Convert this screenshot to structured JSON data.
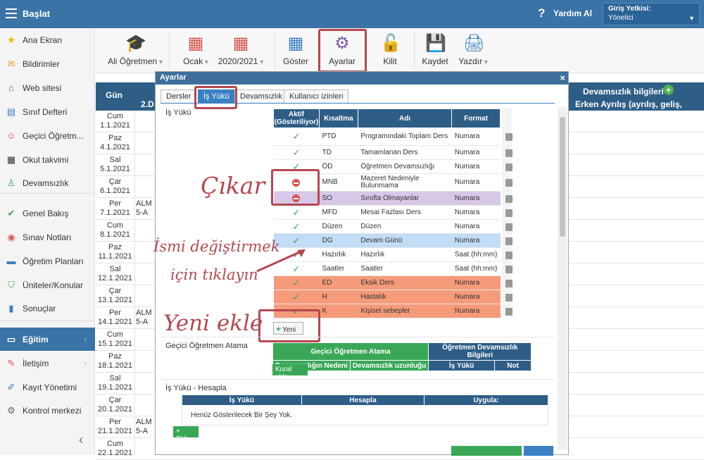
{
  "topbar": {
    "title": "Başlat",
    "help": "Yardım Al",
    "role_label": "Giriş Yetkisi:",
    "role_value": "Yönetici"
  },
  "sidebar": {
    "items": [
      {
        "label": "Ana Ekran",
        "icon": "star-icon"
      },
      {
        "label": "Bildirimler",
        "icon": "envelope-icon"
      },
      {
        "label": "Web sitesi",
        "icon": "home-icon"
      },
      {
        "label": "Sınıf Defteri",
        "icon": "notebook-icon"
      },
      {
        "label": "Geçici Öğretm...",
        "icon": "user-icon"
      },
      {
        "label": "Okul takvimi",
        "icon": "calendar-icon"
      },
      {
        "label": "Devamsızlık",
        "icon": "person-icon"
      },
      {
        "label": "Genel Bakış",
        "icon": "check-circle-icon"
      },
      {
        "label": "Sınav Notları",
        "icon": "chart-circle-icon"
      },
      {
        "label": "Öğretim Planları",
        "icon": "briefcase-icon"
      },
      {
        "label": "Üniteler/Konular",
        "icon": "shield-icon"
      },
      {
        "label": "Sonuçlar",
        "icon": "bar-chart-icon"
      },
      {
        "label": "Eğitim",
        "icon": "book-icon"
      },
      {
        "label": "İletişim",
        "icon": "chat-icon"
      },
      {
        "label": "Kayıt Yönetimi",
        "icon": "pencil-icon"
      },
      {
        "label": "Kontrol merkezi",
        "icon": "gear-icon"
      }
    ]
  },
  "toolbar": {
    "items": [
      {
        "label": "Ali Öğretmen",
        "icon": "graduation-cap-icon",
        "dropdown": true
      },
      {
        "label": "Ocak",
        "icon": "calendar-icon",
        "dropdown": true
      },
      {
        "label": "2020/2021",
        "icon": "calendar-icon",
        "dropdown": true
      },
      {
        "label": "Göster",
        "icon": "grid-icon",
        "dropdown": false
      },
      {
        "label": "Ayarlar",
        "icon": "gear-icon",
        "dropdown": false
      },
      {
        "label": "Kilit",
        "icon": "lock-icon",
        "dropdown": false
      },
      {
        "label": "Kaydet",
        "icon": "floppy-icon",
        "dropdown": false
      },
      {
        "label": "Yazdır",
        "icon": "printer-icon",
        "dropdown": true
      }
    ]
  },
  "grid": {
    "gun": "Gün",
    "col2": "2.D",
    "devam": "Devamsızlık bilgileri",
    "erken": "Erken Ayrılış (ayrılış, geliş, sebep)",
    "rows": [
      {
        "day": "Cum",
        "date": "1.1.2021",
        "extra": ""
      },
      {
        "day": "Paz",
        "date": "4.1.2021",
        "extra": ""
      },
      {
        "day": "Sal",
        "date": "5.1.2021",
        "extra": ""
      },
      {
        "day": "Çar",
        "date": "6.1.2021",
        "extra": ""
      },
      {
        "day": "Per",
        "date": "7.1.2021",
        "extra": "ALM\n5-A"
      },
      {
        "day": "Cum",
        "date": "8.1.2021",
        "extra": ""
      },
      {
        "day": "Paz",
        "date": "11.1.2021",
        "extra": ""
      },
      {
        "day": "Sal",
        "date": "12.1.2021",
        "extra": ""
      },
      {
        "day": "Çar",
        "date": "13.1.2021",
        "extra": ""
      },
      {
        "day": "Per",
        "date": "14.1.2021",
        "extra": "ALM\n5-A"
      },
      {
        "day": "Cum",
        "date": "15.1.2021",
        "extra": ""
      },
      {
        "day": "Paz",
        "date": "18.1.2021",
        "extra": ""
      },
      {
        "day": "Sal",
        "date": "19.1.2021",
        "extra": ""
      },
      {
        "day": "Çar",
        "date": "20.1.2021",
        "extra": ""
      },
      {
        "day": "Per",
        "date": "21.1.2021",
        "extra": "ALM\n5-A"
      },
      {
        "day": "Cum",
        "date": "22.1.2021",
        "extra": ""
      }
    ]
  },
  "dialog": {
    "title": "Ayarlar",
    "tabs": [
      "Dersler",
      "İş Yükü",
      "Devamsızlık",
      "Kullanıcı izinleri"
    ],
    "section_label": "İş Yükü",
    "columns": [
      "Aktif (Gösteriliyor)",
      "Kısaltma",
      "Adı",
      "Format"
    ],
    "rows": [
      {
        "active": "check",
        "abbr": "PTD",
        "name": "Programındaki Toplam Ders",
        "format": "Numara",
        "style": ""
      },
      {
        "active": "check",
        "abbr": "TD",
        "name": "Tamamlanan Ders",
        "format": "Numara",
        "style": ""
      },
      {
        "active": "check",
        "abbr": "ÖD",
        "name": "Öğretmen Devamsızlığı",
        "format": "Numara",
        "style": ""
      },
      {
        "active": "stop",
        "abbr": "MNB",
        "name": "Mazeret Nedeniyle Bulunmama",
        "format": "Numara",
        "style": ""
      },
      {
        "active": "stop",
        "abbr": "SO",
        "name": "Sınıfta Olmayanlar",
        "format": "Numara",
        "style": "purple"
      },
      {
        "active": "check",
        "abbr": "MFD",
        "name": "Mesai Fazlası Ders",
        "format": "Numara",
        "style": ""
      },
      {
        "active": "check",
        "abbr": "Düzen",
        "name": "Düzen",
        "format": "Numara",
        "style": ""
      },
      {
        "active": "check",
        "abbr": "DG",
        "name": "Devam Günü",
        "format": "Numara",
        "style": "blue"
      },
      {
        "active": "check",
        "abbr": "Hazırlık",
        "name": "Hazırlık",
        "format": "Saat (hh:mm)",
        "style": ""
      },
      {
        "active": "check",
        "abbr": "Saatler",
        "name": "Saatler",
        "format": "Saat (hh:mm)",
        "style": ""
      },
      {
        "active": "check",
        "abbr": "ED",
        "name": "Eksik Ders",
        "format": "Numara",
        "style": "orange"
      },
      {
        "active": "check",
        "abbr": "H",
        "name": "Hastalık",
        "format": "Numara",
        "style": "orange"
      },
      {
        "active": "check",
        "abbr": "K",
        "name": "Kişisel sebepler",
        "format": "Numara",
        "style": "orange"
      }
    ],
    "yeni": "Yeni",
    "gecici_label": "Geçici Öğretmen Atama",
    "ta_head1": "Geçici Öğretmen Atama",
    "ta_head2": "Öğretmen Devamsızlık Bilgileri",
    "ta_sub": [
      "Devamsızlığın Nedeni",
      "Devamsızlık uzunluğu",
      "İş Yükü",
      "Not"
    ],
    "kural": "Kural ekle",
    "hesap_label": "İş Yükü - Hesapla",
    "hesap_cols": [
      "İş Yükü",
      "Hesapla",
      "Uygula:"
    ],
    "hesap_empty": "Henüz Gösterilecek Bir Şey Yok.",
    "ekle": "+ Ekle"
  },
  "annotations": {
    "cikar": "Çıkar",
    "ismi1": "İsmi değiştirmek",
    "ismi2": "için tıklayın",
    "yeni": "Yeni ekle"
  },
  "colors": {
    "topbar": "#3a73a6",
    "header": "#2e5d86",
    "accent": "#b5474f",
    "green": "#3aa757"
  }
}
